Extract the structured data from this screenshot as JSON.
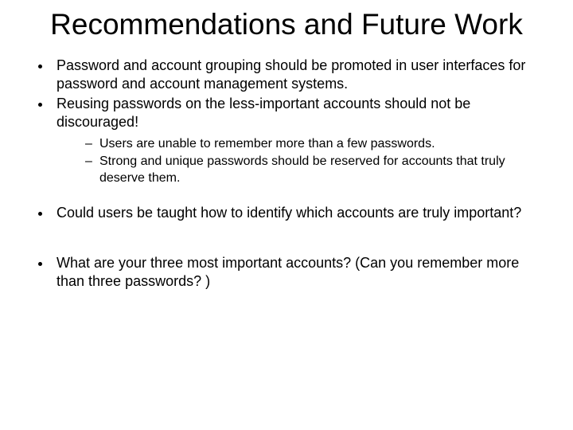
{
  "title": "Recommendations and Future Work",
  "bullets": {
    "item0": "Password and account grouping should be promoted in user interfaces for password and account management systems.",
    "item1": "Reusing passwords on the less-important accounts should not be discouraged!",
    "sub0": "Users are unable to remember more than a few passwords.",
    "sub1": "Strong and unique passwords should be reserved for accounts that truly deserve them.",
    "item2": "Could users be taught how to identify which accounts are truly important?",
    "item3": "What are your three most important accounts?  (Can you remember more than three passwords? )"
  }
}
